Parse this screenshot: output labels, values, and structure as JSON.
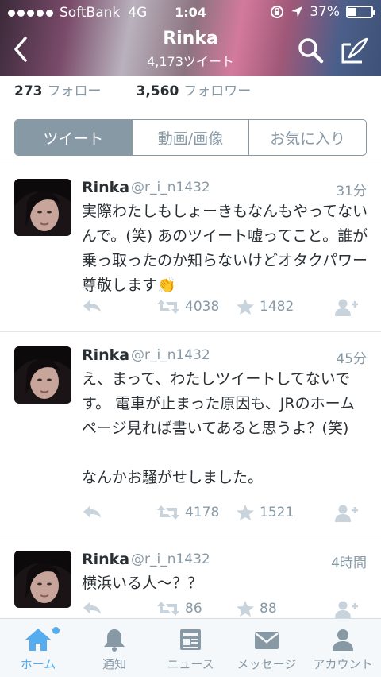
{
  "status_bar": {
    "carrier": "SoftBank",
    "network": "4G",
    "time": "1:04",
    "battery": "37%",
    "battery_level": 0.37
  },
  "header": {
    "title": "Rinka",
    "subtitle": "4,173ツイート"
  },
  "stats": {
    "following_count": "273",
    "following_label": "フォロー",
    "followers_count": "3,560",
    "followers_label": "フォロワー"
  },
  "tabs": [
    {
      "label": "ツイート",
      "active": true
    },
    {
      "label": "動画/画像",
      "active": false
    },
    {
      "label": "お気に入り",
      "active": false
    }
  ],
  "tweets": [
    {
      "name": "Rinka",
      "handle": "@r_i_n1432",
      "age": "31分",
      "text": "実際わたしもしょーきもなんもやってないんで。(笑) あのツイート嘘ってこと。誰が乗っ取ったのか知らないけどオタクパワー尊敬します👏",
      "retweets": "4038",
      "favorites": "1482"
    },
    {
      "name": "Rinka",
      "handle": "@r_i_n1432",
      "age": "45分",
      "text": "え、まって、わたしツイートしてないです。 電車が止まった原因も、JRのホームページ見れば書いてあると思うよ？(笑)\n\nなんかお騒がせしました。",
      "retweets": "4178",
      "favorites": "1521"
    },
    {
      "name": "Rinka",
      "handle": "@r_i_n1432",
      "age": "4時間",
      "text": "横浜いる人〜？？",
      "retweets": "86",
      "favorites": "88"
    }
  ],
  "tabbar": [
    {
      "label": "ホーム",
      "icon": "home-icon",
      "active": true
    },
    {
      "label": "通知",
      "icon": "bell-icon",
      "active": false
    },
    {
      "label": "ニュース",
      "icon": "news-icon",
      "active": false
    },
    {
      "label": "メッセージ",
      "icon": "envelope-icon",
      "active": false
    },
    {
      "label": "アカウント",
      "icon": "person-icon",
      "active": false
    }
  ],
  "colors": {
    "accent": "#55acee",
    "muted": "#8899a6",
    "text": "#292f33"
  }
}
